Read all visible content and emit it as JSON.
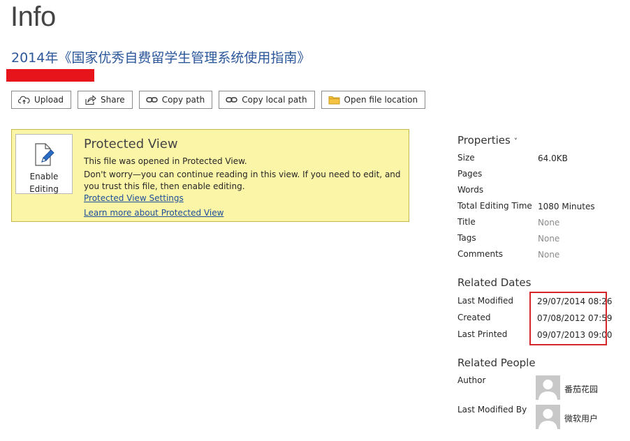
{
  "page": {
    "title": "Info",
    "doc_title": "2014年《国家优秀自费留学生管理系统使用指南》"
  },
  "toolbar": {
    "buttons": [
      {
        "label": "Upload",
        "icon": "cloud-upload-icon"
      },
      {
        "label": "Share",
        "icon": "share-icon"
      },
      {
        "label": "Copy path",
        "icon": "link-icon"
      },
      {
        "label": "Copy local path",
        "icon": "link-icon"
      },
      {
        "label": "Open file location",
        "icon": "folder-icon"
      }
    ]
  },
  "protected_view": {
    "enable_button_line1": "Enable",
    "enable_button_line2": "Editing",
    "heading": "Protected View",
    "line1": "This file was opened in Protected View.",
    "line2": "Don't worry—you can continue reading in this view. If you need to edit, and you trust this file, then enable editing.",
    "settings_link": "Protected View Settings",
    "learn_link": "Learn more about Protected View",
    "background": "#fbf5a8"
  },
  "properties": {
    "heading": "Properties",
    "caret": "˅",
    "items": [
      {
        "label": "Size",
        "value": "64.0KB"
      },
      {
        "label": "Pages",
        "value": ""
      },
      {
        "label": "Words",
        "value": ""
      },
      {
        "label": "Total Editing Time",
        "value": "1080 Minutes"
      },
      {
        "label": "Title",
        "value": "None"
      },
      {
        "label": "Tags",
        "value": "None"
      },
      {
        "label": "Comments",
        "value": "None"
      }
    ]
  },
  "related_dates": {
    "heading": "Related Dates",
    "items": [
      {
        "label": "Last Modified",
        "value": "29/07/2014 08:26"
      },
      {
        "label": "Created",
        "value": "07/08/2012 07:59"
      },
      {
        "label": "Last Printed",
        "value": "09/07/2013 09:00"
      }
    ],
    "highlight_color": "#d6262a"
  },
  "related_people": {
    "heading": "Related People",
    "items": [
      {
        "label": "Author",
        "name": "番茄花园"
      },
      {
        "label": "Last Modified By",
        "name": "微软用户"
      }
    ]
  }
}
